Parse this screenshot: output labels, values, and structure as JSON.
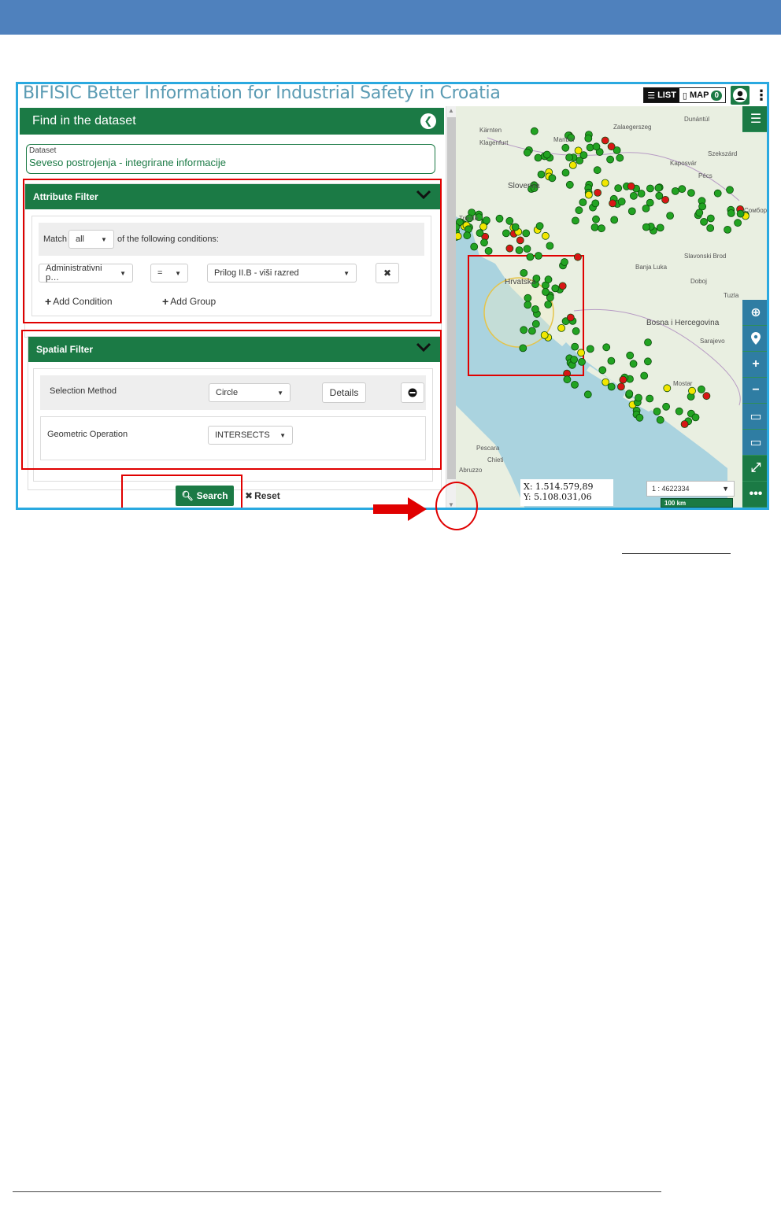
{
  "app": {
    "title": "BIFISIC Better Information for Industrial Safety in Croatia",
    "list_label": "LIST",
    "map_label": "MAP",
    "map_count": "0"
  },
  "panel": {
    "title": "Find in the dataset",
    "dataset_label": "Dataset",
    "dataset_value": "Seveso postrojenja - integrirane informacije"
  },
  "attribute_filter": {
    "title": "Attribute Filter",
    "match_prefix": "Match",
    "match_value": "all",
    "match_suffix": "of the following conditions:",
    "field_value": "Administrativni p…",
    "operator_value": "=",
    "value_value": "Prilog II.B - viši razred",
    "add_condition": "Add Condition",
    "add_group": "Add Group"
  },
  "spatial_filter": {
    "title": "Spatial Filter",
    "selection_method_label": "Selection Method",
    "selection_method_value": "Circle",
    "details_label": "Details",
    "geometric_operation_label": "Geometric Operation",
    "geometric_operation_value": "INTERSECTS"
  },
  "actions": {
    "search_label": "Search",
    "reset_label": "Reset"
  },
  "map": {
    "labels": {
      "karnten": "Kärnten",
      "klagenfurt": "Klagenfurt",
      "maribor": "Maribor",
      "zalaegerszeg": "Zalaegerszeg",
      "dunantul": "Dunántúl",
      "szekszard": "Szekszárd",
      "kaposvar": "Kaposvár",
      "pecs": "Pécs",
      "slovenija": "Slovenija",
      "trieste": "Trieste",
      "sombor": "Сомбор",
      "slavonski_brod": "Slavonski Brod",
      "hrvatska": "Hrvatska",
      "banja_luka": "Banja Luka",
      "doboj": "Doboj",
      "tuzla": "Tuzla",
      "bih": "Bosna i Hercegovina",
      "sarajevo": "Sarajevo",
      "mostar": "Mostar",
      "pescara": "Pescara",
      "chieti": "Chieti",
      "abruzzo": "Abruzzo"
    },
    "coord_x": "X: 1.514.579,89",
    "coord_y": "Y: 5.108.031,06",
    "scale_value": "1 : 4622334",
    "scale_bar_label": "100 km",
    "colors": {
      "ok": "#22a322",
      "warn": "#f2e600",
      "alert": "#d81616",
      "sea": "#aad3df",
      "land": "#e9efe1"
    }
  }
}
